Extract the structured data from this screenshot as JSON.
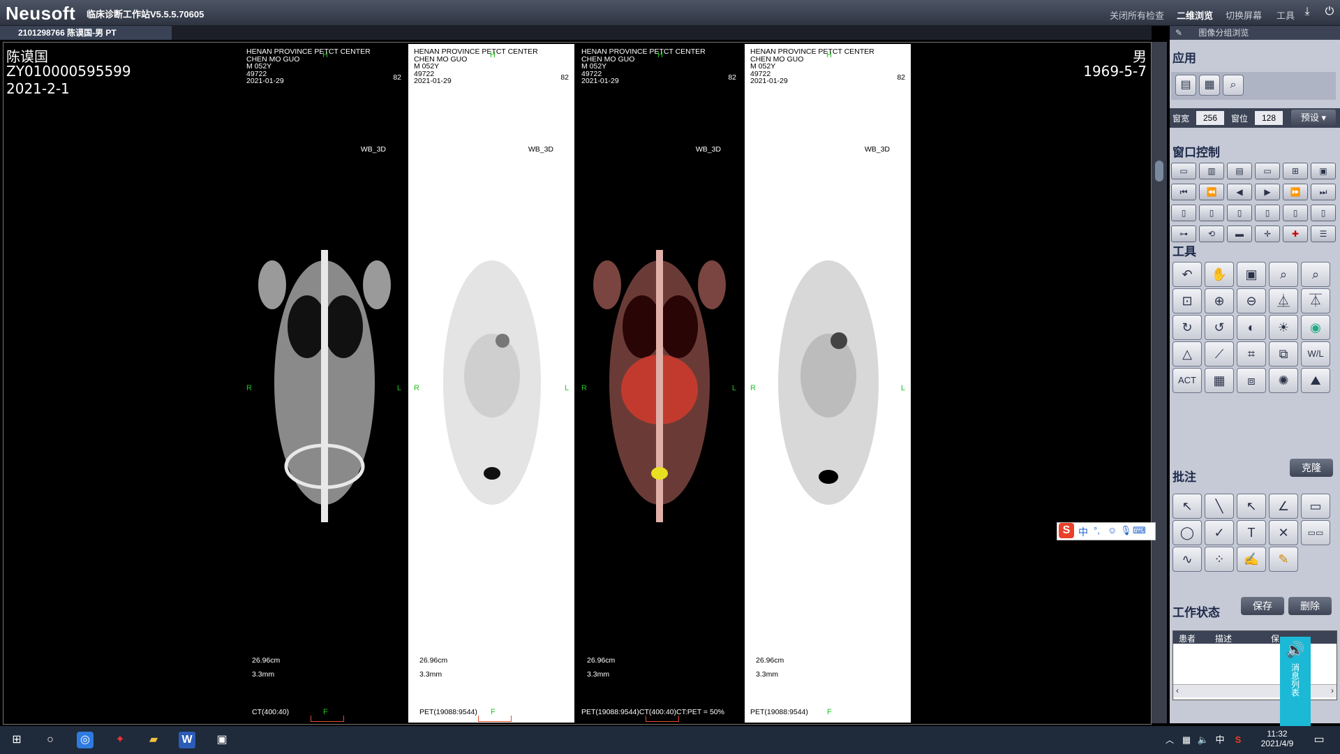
{
  "titlebar": {
    "brand": "Neusoft",
    "app_title": "临床诊断工作站V5.5.5.70605",
    "menu": [
      "关闭所有检查",
      "二维浏览",
      "切换屏幕",
      "工具"
    ],
    "active_menu": "二维浏览"
  },
  "study_tab": "2101298766 陈谟国-男 PT",
  "patient": {
    "name": "陈谟国",
    "id": "ZY010000595599",
    "study_date": "2021-2-1",
    "sex": "男",
    "birth": "1969-5-7"
  },
  "panels": [
    {
      "theme": "dark",
      "info": [
        "HENAN PROVINCE PETCT CENTER",
        "CHEN MO GUO",
        "M  052Y",
        "49722",
        "2021-01-29"
      ],
      "num": "82",
      "series": "WB_3D",
      "dist": "26.96cm",
      "thick": "3.3mm",
      "window": "CT(400:40)",
      "orient_r": "R",
      "orient_l": "L",
      "orient_h": "H",
      "orient_f": "F"
    },
    {
      "theme": "light",
      "info": [
        "HENAN PROVINCE PETCT CENTER",
        "CHEN MO GUO",
        "M  052Y",
        "49722",
        "2021-01-29"
      ],
      "num": "82",
      "series": "WB_3D",
      "dist": "26.96cm",
      "thick": "3.3mm",
      "window": "PET(19088:9544)",
      "orient_r": "R",
      "orient_l": "L",
      "orient_h": "H",
      "orient_f": "F"
    },
    {
      "theme": "dark",
      "info": [
        "HENAN PROVINCE PETCT CENTER",
        "CHEN MO GUO",
        "M  052Y",
        "49722",
        "2021-01-29"
      ],
      "num": "82",
      "series": "WB_3D",
      "dist": "26.96cm",
      "thick": "3.3mm",
      "window": "PET(19088:9544)CT(400:40)CT:PET = 50%",
      "orient_r": "R",
      "orient_l": "L",
      "orient_h": "H",
      "orient_f": "F"
    },
    {
      "theme": "light",
      "info": [
        "HENAN PROVINCE PETCT CENTER",
        "CHEN MO GUO",
        "M  052Y",
        "49722",
        "2021-01-29"
      ],
      "num": "82",
      "series": "WB_3D",
      "dist": "26.96cm",
      "thick": "3.3mm",
      "window": "PET(19088:9544)",
      "orient_r": "R",
      "orient_l": "L",
      "orient_h": "H",
      "orient_f": "F"
    }
  ],
  "right_panel": {
    "header": "图像分组浏览",
    "sections": {
      "apply": "应用",
      "window_control": "窗口控制",
      "tools": "工具",
      "annotate": "批注",
      "work_status": "工作状态"
    },
    "ww_label": "窗宽",
    "ww_value": "256",
    "wl_label": "窗位",
    "wl_value": "128",
    "preset": "预设",
    "clone": "克隆",
    "save": "保存",
    "delete": "删除",
    "table_headers": [
      "患者",
      "描述",
      "保"
    ]
  },
  "message_list": "消息列表",
  "taskbar": {
    "time": "11:32",
    "date": "2021/4/9",
    "ime": "中"
  },
  "colors": {
    "accent": "#3b4355",
    "panel_bg": "#c5cad6",
    "orient": "#1fc41f",
    "msg": "#1bb9d6"
  }
}
